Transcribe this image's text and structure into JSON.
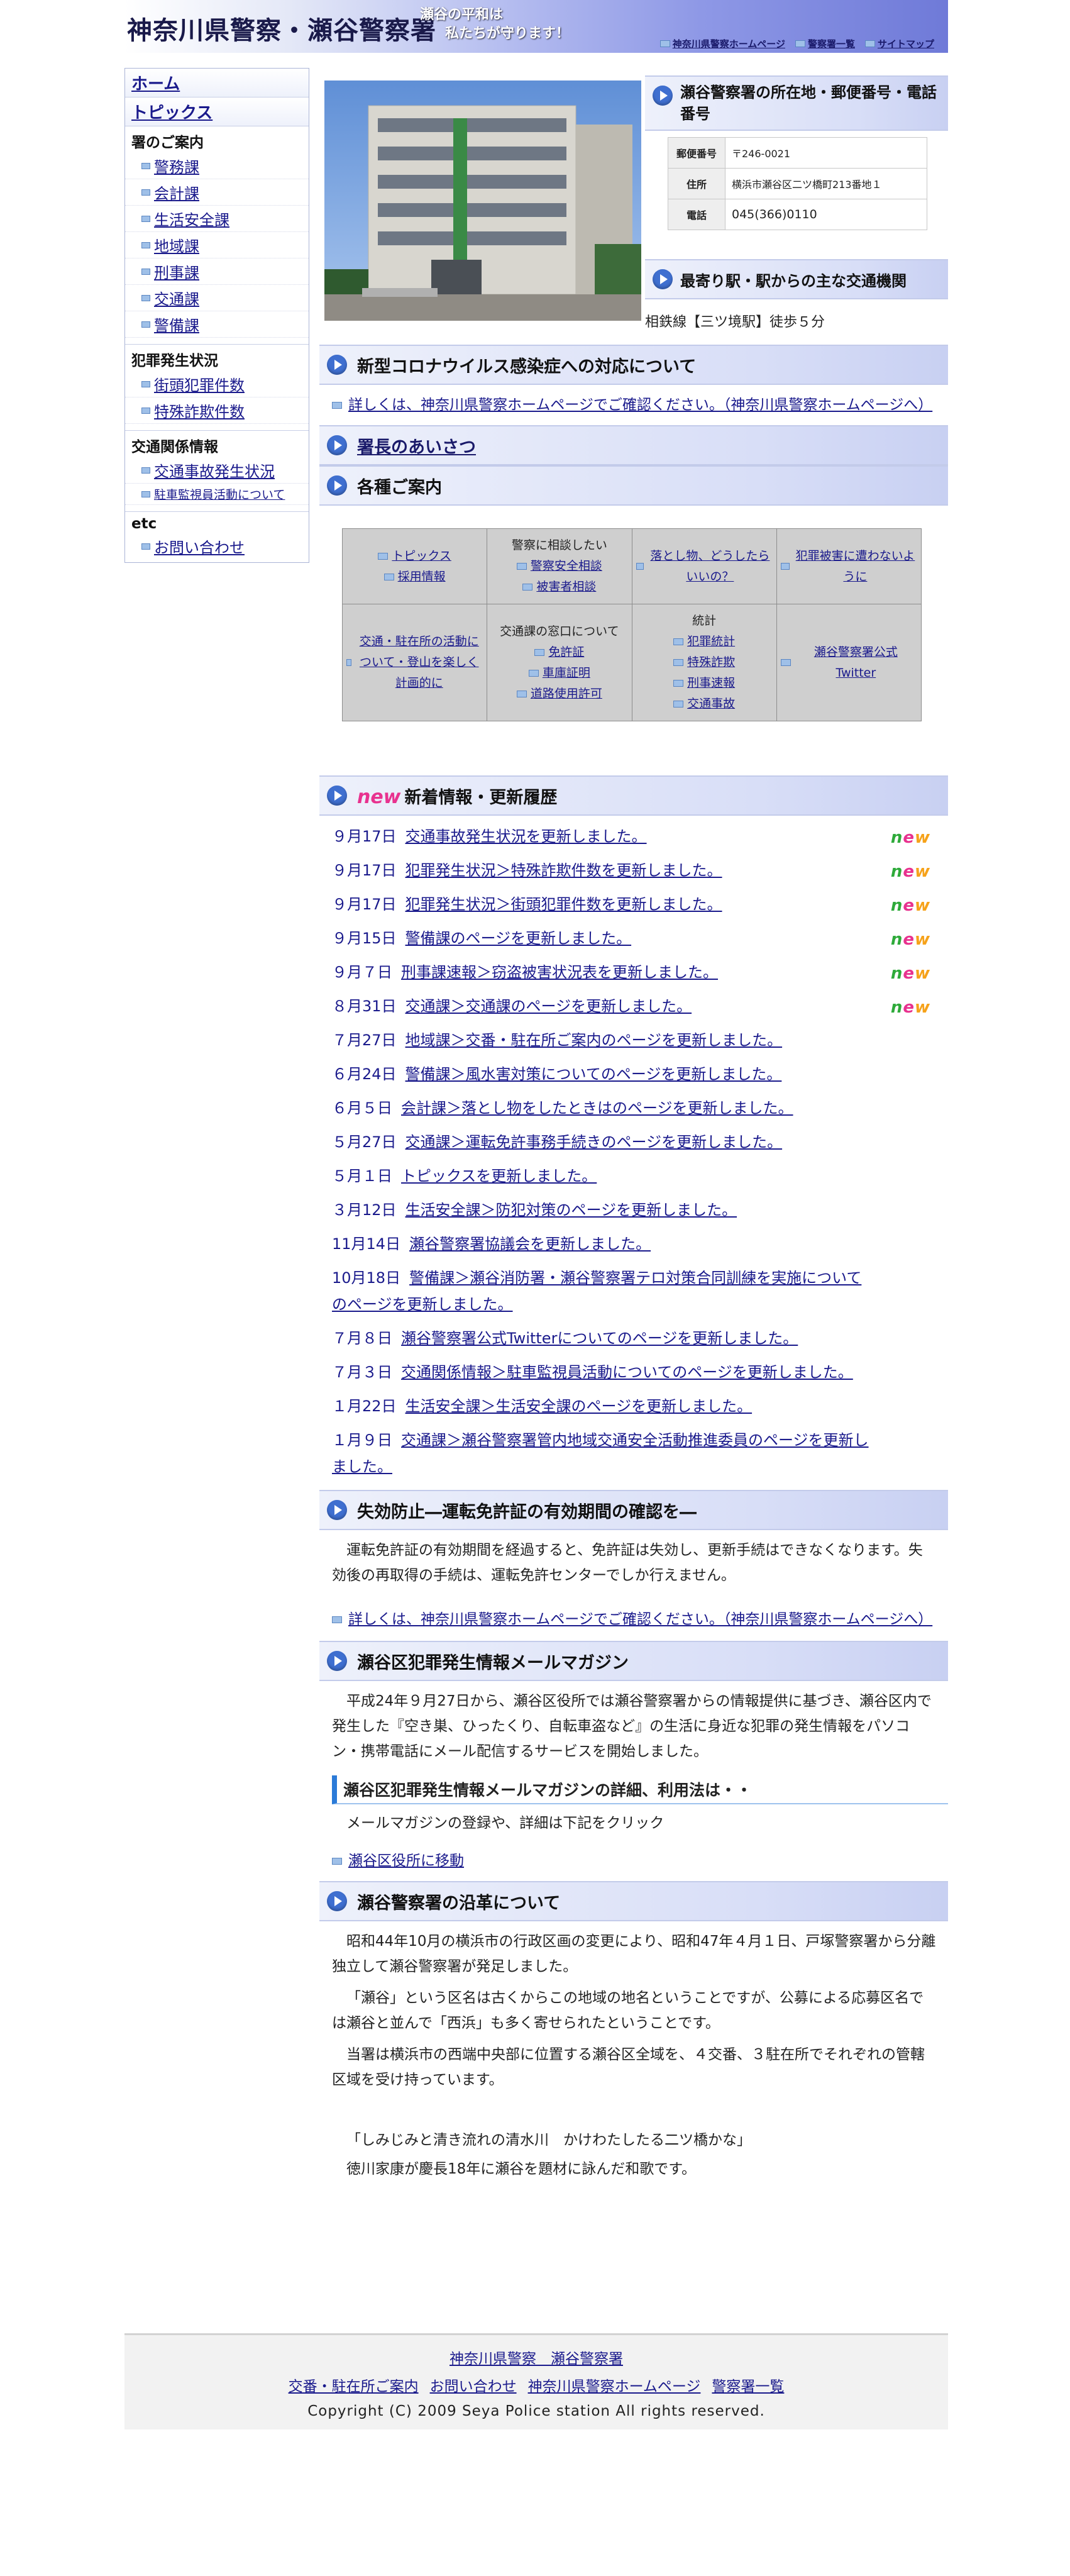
{
  "header": {
    "site_title": "神奈川県警察・瀬谷警察署",
    "slogan_line1": "瀬谷の平和は",
    "slogan_line2": "私たちが守ります！",
    "nav": [
      "神奈川県警察ホームページ",
      "警察署一覧",
      "サイトマップ"
    ]
  },
  "sidebar": {
    "home": "ホーム",
    "topics": "トピックス",
    "groups": [
      {
        "title": "署のご案内",
        "items": [
          "警務課",
          "会計課",
          "生活安全課",
          "地域課",
          "刑事課",
          "交通課",
          "警備課"
        ]
      },
      {
        "title": "犯罪発生状況",
        "items": [
          "街頭犯罪件数",
          "特殊詐欺件数"
        ]
      },
      {
        "title": "交通関係情報",
        "items": [
          "交通事故発生状況",
          "駐車監視員活動について"
        ]
      },
      {
        "title": "etc",
        "items": [
          "お問い合わせ"
        ]
      }
    ]
  },
  "station": {
    "location_heading": "瀬谷警察署の所在地・郵便番号・電話番号",
    "rows": [
      {
        "key": "郵便番号",
        "value": "〒246-0021"
      },
      {
        "key": "住所",
        "value": "横浜市瀬谷区二ツ橋町213番地１"
      },
      {
        "key": "電話",
        "value": "045(366)0110"
      }
    ],
    "access_heading": "最寄り駅・駅からの主な交通機関",
    "access_text": "相鉄線【三ツ境駅】徒歩５分"
  },
  "covid": {
    "heading": "新型コロナウイルス感染症への対応について",
    "link": "詳しくは、神奈川県警察ホームページでご確認ください。（神奈川県警察ホームページへ）"
  },
  "chief": {
    "heading": "署長のあいさつ"
  },
  "guide": {
    "heading": "各種ご案内",
    "cells": [
      {
        "caption": "",
        "links": [
          "トピックス",
          "採用情報"
        ]
      },
      {
        "caption": "警察に相談したい",
        "links": [
          "警察安全相談",
          "被害者相談"
        ]
      },
      {
        "caption": "",
        "links": [
          "落とし物、どうしたらいいの？"
        ]
      },
      {
        "caption": "",
        "links": [
          "犯罪被害に遭わないように"
        ]
      },
      {
        "caption": "",
        "links": [
          "交通・駐在所の活動について・登山を楽しく計画的に"
        ]
      },
      {
        "caption": "交通課の窓口について",
        "links": [
          "免許証",
          "車庫証明",
          "道路使用許可"
        ]
      },
      {
        "caption": "統計",
        "links": [
          "犯罪統計",
          "特殊詐欺",
          "刑事速報",
          "交通事故"
        ]
      },
      {
        "caption": "",
        "links": [
          "瀬谷警察署公式Twitter"
        ]
      }
    ]
  },
  "news": {
    "badge": "new",
    "heading": "新着情報・更新履歴",
    "new_mark": "new",
    "items": [
      {
        "date": "９月17日",
        "text": "交通事故発生状況を更新しました。",
        "new": true
      },
      {
        "date": "９月17日",
        "text": "犯罪発生状況＞特殊詐欺件数を更新しました。",
        "new": true
      },
      {
        "date": "９月17日",
        "text": "犯罪発生状況＞街頭犯罪件数を更新しました。",
        "new": true
      },
      {
        "date": "９月15日",
        "text": "警備課のページを更新しました。",
        "new": true
      },
      {
        "date": "９月７日",
        "text": "刑事課速報＞窃盗被害状況表を更新しました。",
        "new": true
      },
      {
        "date": "８月31日",
        "text": "交通課＞交通課のページを更新しました。",
        "new": true
      },
      {
        "date": "７月27日",
        "text": "地域課＞交番・駐在所ご案内のページを更新しました。",
        "new": false
      },
      {
        "date": "６月24日",
        "text": "警備課＞風水害対策についてのページを更新しました。",
        "new": false
      },
      {
        "date": "６月５日",
        "text": "会計課＞落とし物をしたときはのページを更新しました。",
        "new": false
      },
      {
        "date": "５月27日",
        "text": "交通課＞運転免許事務手続きのページを更新しました。",
        "new": false
      },
      {
        "date": "５月１日",
        "text": "トピックスを更新しました。",
        "new": false
      },
      {
        "date": "３月12日",
        "text": "生活安全課＞防犯対策のページを更新しました。",
        "new": false
      },
      {
        "date": "11月14日",
        "text": "瀬谷警察署協議会を更新しました。",
        "new": false
      },
      {
        "date": "10月18日",
        "text": "警備課＞瀬谷消防署・瀬谷警察署テロ対策合同訓練を実施についてのページを更新しました。",
        "new": false
      },
      {
        "date": "７月８日",
        "text": "瀬谷警察署公式Twitterについてのページを更新しました。",
        "new": false
      },
      {
        "date": "７月３日",
        "text": "交通関係情報＞駐車監視員活動についてのページを更新しました。",
        "new": false
      },
      {
        "date": "１月22日",
        "text": "生活安全課＞生活安全課のページを更新しました。",
        "new": false
      },
      {
        "date": "１月９日",
        "text": "交通課＞瀬谷警察署管内地域交通安全活動推進委員のページを更新しました。",
        "new": false
      }
    ]
  },
  "license": {
    "heading": "失効防止―運転免許証の有効期間の確認を―",
    "text": "運転免許証の有効期間を経過すると、免許証は失効し、更新手続はできなくなります。失効後の再取得の手続は、運転免許センターでしか行えません。",
    "link": "詳しくは、神奈川県警察ホームページでご確認ください。（神奈川県警察ホームページへ）"
  },
  "mail": {
    "heading": "瀬谷区犯罪発生情報メールマガジン",
    "text": "平成24年９月27日から、瀬谷区役所では瀬谷警察署からの情報提供に基づき、瀬谷区内で発生した『空き巣、ひったくり、自転車盗など』の生活に身近な犯罪の発生情報をパソコン・携帯電話にメール配信するサービスを開始しました。",
    "sub_heading": "瀬谷区犯罪発生情報メールマガジンの詳細、利用法は・・",
    "sub_text": "メールマガジンの登録や、詳細は下記をクリック",
    "link": "瀬谷区役所に移動"
  },
  "history": {
    "heading": "瀬谷警察署の沿革について",
    "p1": "昭和44年10月の横浜市の行政区画の変更により、昭和47年４月１日、戸塚警察署から分離独立して瀬谷警察署が発足しました。",
    "p2": "「瀬谷」という区名は古くからこの地域の地名ということですが、公募による応募区名では瀬谷と並んで「西浜」も多く寄せられたということです。",
    "p3": "当署は横浜市の西端中央部に位置する瀬谷区全域を、４交番、３駐在所でそれぞれの管轄区域を受け持っています。",
    "poem": "「しみじみと清き流れの清水川　かけわたしたる二ツ橋かな」",
    "poem_note": "徳川家康が慶長18年に瀬谷を題材に詠んだ和歌です。"
  },
  "footer": {
    "line1": "神奈川県警察　瀬谷警察署",
    "links": [
      "交番・駐在所ご案内",
      "お問い合わせ",
      "神奈川県警察ホームページ",
      "警察署一覧"
    ],
    "copyright": "Copyright (C) 2009 Seya Police station All rights reserved."
  }
}
